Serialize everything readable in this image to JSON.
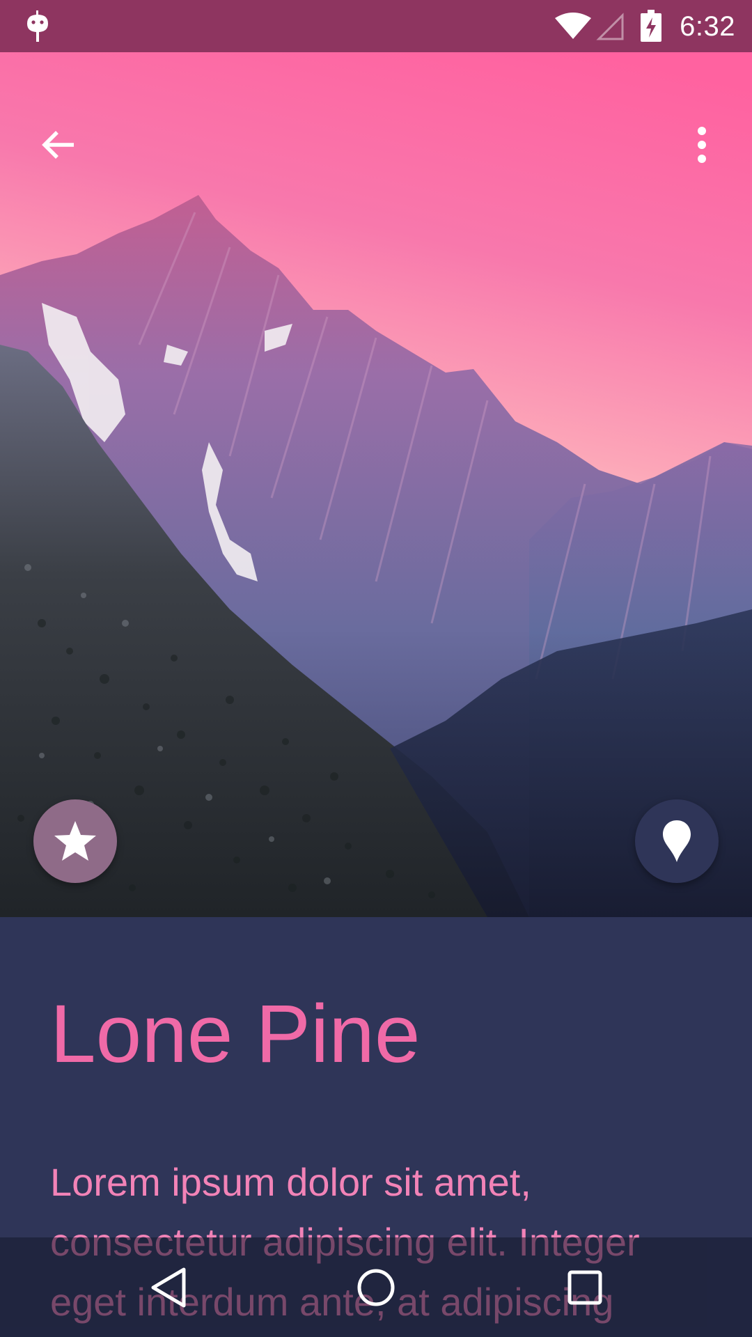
{
  "status_bar": {
    "time": "6:32",
    "icons": [
      "android-icon",
      "wifi-icon",
      "signal-icon",
      "battery-charging-icon"
    ]
  },
  "toolbar": {
    "back_icon": "arrow-back-icon",
    "more_icon": "more-vert-icon"
  },
  "actions": {
    "favorite_icon": "star-icon",
    "location_icon": "map-pin-icon"
  },
  "content": {
    "title": "Lone Pine",
    "body": "Lorem ipsum dolor sit amet, consectetur adipiscing elit. Integer eget interdum ante, at adipiscing"
  },
  "nav_bar": {
    "icons": [
      "back-triangle-icon",
      "home-circle-icon",
      "recents-square-icon"
    ]
  },
  "colors": {
    "status_bar": "#8e3560",
    "sky_top": "#ff66a3",
    "sky_bottom": "#ffd0c8",
    "panel": "#2f3558",
    "title": "#f06aa7",
    "body": "#f283b7",
    "fab_favorite": "#8f6b88",
    "fab_location": "#2f3558"
  }
}
